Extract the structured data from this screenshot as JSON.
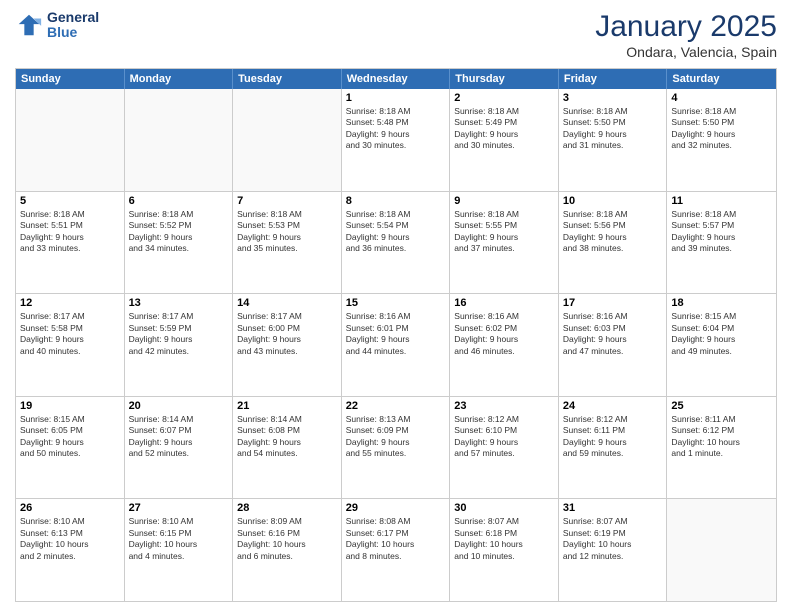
{
  "header": {
    "logo_line1": "General",
    "logo_line2": "Blue",
    "month": "January 2025",
    "location": "Ondara, Valencia, Spain"
  },
  "weekdays": [
    "Sunday",
    "Monday",
    "Tuesday",
    "Wednesday",
    "Thursday",
    "Friday",
    "Saturday"
  ],
  "weeks": [
    [
      {
        "day": "",
        "text": ""
      },
      {
        "day": "",
        "text": ""
      },
      {
        "day": "",
        "text": ""
      },
      {
        "day": "1",
        "text": "Sunrise: 8:18 AM\nSunset: 5:48 PM\nDaylight: 9 hours\nand 30 minutes."
      },
      {
        "day": "2",
        "text": "Sunrise: 8:18 AM\nSunset: 5:49 PM\nDaylight: 9 hours\nand 30 minutes."
      },
      {
        "day": "3",
        "text": "Sunrise: 8:18 AM\nSunset: 5:50 PM\nDaylight: 9 hours\nand 31 minutes."
      },
      {
        "day": "4",
        "text": "Sunrise: 8:18 AM\nSunset: 5:50 PM\nDaylight: 9 hours\nand 32 minutes."
      }
    ],
    [
      {
        "day": "5",
        "text": "Sunrise: 8:18 AM\nSunset: 5:51 PM\nDaylight: 9 hours\nand 33 minutes."
      },
      {
        "day": "6",
        "text": "Sunrise: 8:18 AM\nSunset: 5:52 PM\nDaylight: 9 hours\nand 34 minutes."
      },
      {
        "day": "7",
        "text": "Sunrise: 8:18 AM\nSunset: 5:53 PM\nDaylight: 9 hours\nand 35 minutes."
      },
      {
        "day": "8",
        "text": "Sunrise: 8:18 AM\nSunset: 5:54 PM\nDaylight: 9 hours\nand 36 minutes."
      },
      {
        "day": "9",
        "text": "Sunrise: 8:18 AM\nSunset: 5:55 PM\nDaylight: 9 hours\nand 37 minutes."
      },
      {
        "day": "10",
        "text": "Sunrise: 8:18 AM\nSunset: 5:56 PM\nDaylight: 9 hours\nand 38 minutes."
      },
      {
        "day": "11",
        "text": "Sunrise: 8:18 AM\nSunset: 5:57 PM\nDaylight: 9 hours\nand 39 minutes."
      }
    ],
    [
      {
        "day": "12",
        "text": "Sunrise: 8:17 AM\nSunset: 5:58 PM\nDaylight: 9 hours\nand 40 minutes."
      },
      {
        "day": "13",
        "text": "Sunrise: 8:17 AM\nSunset: 5:59 PM\nDaylight: 9 hours\nand 42 minutes."
      },
      {
        "day": "14",
        "text": "Sunrise: 8:17 AM\nSunset: 6:00 PM\nDaylight: 9 hours\nand 43 minutes."
      },
      {
        "day": "15",
        "text": "Sunrise: 8:16 AM\nSunset: 6:01 PM\nDaylight: 9 hours\nand 44 minutes."
      },
      {
        "day": "16",
        "text": "Sunrise: 8:16 AM\nSunset: 6:02 PM\nDaylight: 9 hours\nand 46 minutes."
      },
      {
        "day": "17",
        "text": "Sunrise: 8:16 AM\nSunset: 6:03 PM\nDaylight: 9 hours\nand 47 minutes."
      },
      {
        "day": "18",
        "text": "Sunrise: 8:15 AM\nSunset: 6:04 PM\nDaylight: 9 hours\nand 49 minutes."
      }
    ],
    [
      {
        "day": "19",
        "text": "Sunrise: 8:15 AM\nSunset: 6:05 PM\nDaylight: 9 hours\nand 50 minutes."
      },
      {
        "day": "20",
        "text": "Sunrise: 8:14 AM\nSunset: 6:07 PM\nDaylight: 9 hours\nand 52 minutes."
      },
      {
        "day": "21",
        "text": "Sunrise: 8:14 AM\nSunset: 6:08 PM\nDaylight: 9 hours\nand 54 minutes."
      },
      {
        "day": "22",
        "text": "Sunrise: 8:13 AM\nSunset: 6:09 PM\nDaylight: 9 hours\nand 55 minutes."
      },
      {
        "day": "23",
        "text": "Sunrise: 8:12 AM\nSunset: 6:10 PM\nDaylight: 9 hours\nand 57 minutes."
      },
      {
        "day": "24",
        "text": "Sunrise: 8:12 AM\nSunset: 6:11 PM\nDaylight: 9 hours\nand 59 minutes."
      },
      {
        "day": "25",
        "text": "Sunrise: 8:11 AM\nSunset: 6:12 PM\nDaylight: 10 hours\nand 1 minute."
      }
    ],
    [
      {
        "day": "26",
        "text": "Sunrise: 8:10 AM\nSunset: 6:13 PM\nDaylight: 10 hours\nand 2 minutes."
      },
      {
        "day": "27",
        "text": "Sunrise: 8:10 AM\nSunset: 6:15 PM\nDaylight: 10 hours\nand 4 minutes."
      },
      {
        "day": "28",
        "text": "Sunrise: 8:09 AM\nSunset: 6:16 PM\nDaylight: 10 hours\nand 6 minutes."
      },
      {
        "day": "29",
        "text": "Sunrise: 8:08 AM\nSunset: 6:17 PM\nDaylight: 10 hours\nand 8 minutes."
      },
      {
        "day": "30",
        "text": "Sunrise: 8:07 AM\nSunset: 6:18 PM\nDaylight: 10 hours\nand 10 minutes."
      },
      {
        "day": "31",
        "text": "Sunrise: 8:07 AM\nSunset: 6:19 PM\nDaylight: 10 hours\nand 12 minutes."
      },
      {
        "day": "",
        "text": ""
      }
    ]
  ]
}
